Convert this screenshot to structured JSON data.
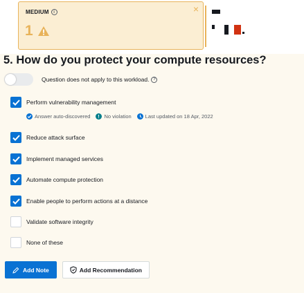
{
  "risk_card": {
    "label": "MEDIUM",
    "count": "1",
    "close_glyph": "×",
    "accent_color": "#e8b35a",
    "warning_icon": "warning-triangle-icon"
  },
  "question": {
    "title": "5. How do you protect your compute resources?",
    "not_applicable_label": "Question does not apply to this workload.",
    "not_applicable_enabled": false
  },
  "meta": {
    "answer_source": "Answer auto-discovered",
    "violation": "No violation",
    "last_updated": "Last updated on 18 Apr, 2022"
  },
  "choices": [
    {
      "label": "Perform vulnerability management",
      "checked": true
    },
    {
      "label": "Reduce attack surface",
      "checked": true
    },
    {
      "label": "Implement managed services",
      "checked": true
    },
    {
      "label": "Automate compute protection",
      "checked": true
    },
    {
      "label": "Enable people to perform actions at a distance",
      "checked": true
    },
    {
      "label": "Validate software integrity",
      "checked": false
    },
    {
      "label": "None of these",
      "checked": false
    }
  ],
  "actions": {
    "add_note": "Add Note",
    "add_recommendation": "Add Recommendation"
  },
  "colors": {
    "primary": "#0972d3",
    "warning": "#e8b35a",
    "success": "#1d8102",
    "info": "#0972d3"
  }
}
